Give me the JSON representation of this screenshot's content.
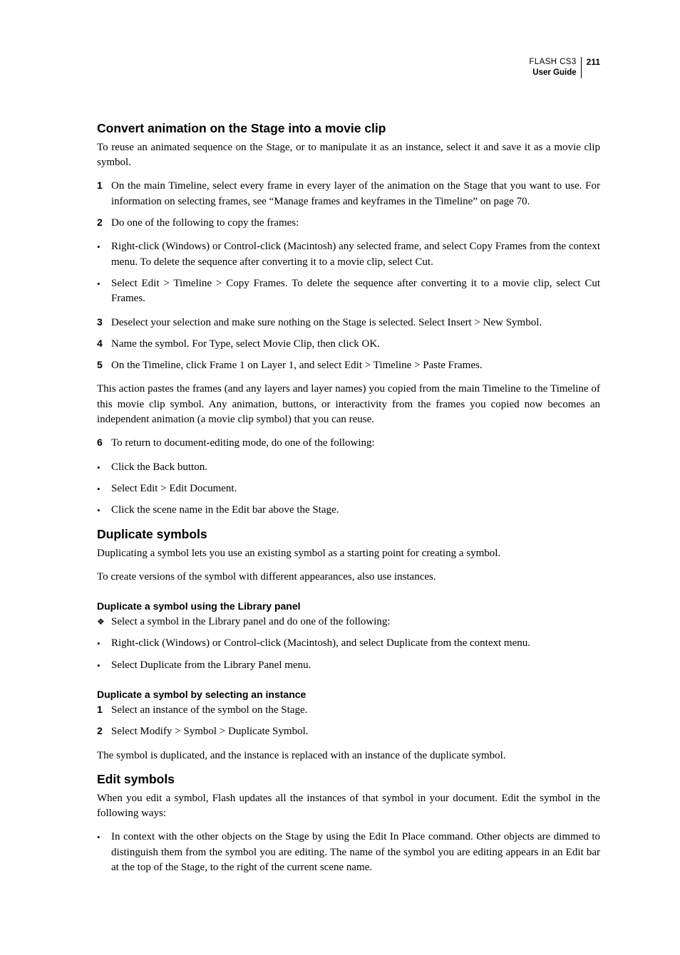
{
  "header": {
    "title": "FLASH CS3",
    "subtitle": "User Guide",
    "page_num": "211"
  },
  "s1": {
    "heading": "Convert animation on the Stage into a movie clip",
    "intro": "To reuse an animated sequence on the Stage, or to manipulate it as an instance, select it and save it as a movie clip symbol.",
    "step1": "On the main Timeline, select every frame in every layer of the animation on the Stage that you want to use. For information on selecting frames, see “Manage frames and keyframes in the Timeline” on page 70.",
    "step2": "Do one of the following to copy the frames:",
    "b2a": "Right-click (Windows) or Control-click (Macintosh) any selected frame, and select Copy Frames from the context menu. To delete the sequence after converting it to a movie clip, select Cut.",
    "b2b": "Select Edit > Timeline > Copy Frames. To delete the sequence after converting it to a movie clip, select Cut Frames.",
    "step3": "Deselect your selection and make sure nothing on the Stage is selected. Select Insert > New Symbol.",
    "step4": "Name the symbol. For Type, select Movie Clip, then click OK.",
    "step5": "On the Timeline, click Frame 1 on Layer 1, and select Edit > Timeline > Paste Frames.",
    "after5": "This action pastes the frames (and any layers and layer names) you copied from the main Timeline to the Timeline of this movie clip symbol. Any animation, buttons, or interactivity from the frames you copied now becomes an independent animation (a movie clip symbol) that you can reuse.",
    "step6": "To return to document-editing mode, do one of the following:",
    "b6a": "Click the Back button.",
    "b6b": "Select Edit > Edit Document.",
    "b6c": "Click the scene name in the Edit bar above the Stage."
  },
  "s2": {
    "heading": "Duplicate symbols",
    "p1": "Duplicating a symbol lets you use an existing symbol as a starting point for creating a symbol.",
    "p2": "To create versions of the symbol with different appearances, also use instances.",
    "sub1": "Duplicate a symbol using the Library panel",
    "d1": "Select a symbol in the Library panel and do one of the following:",
    "b1a": "Right-click (Windows) or Control-click (Macintosh), and select Duplicate from the context menu.",
    "b1b": "Select Duplicate from the Library Panel menu.",
    "sub2": "Duplicate a symbol by selecting an instance",
    "step1": "Select an instance of the symbol on the Stage.",
    "step2": "Select Modify > Symbol > Duplicate Symbol.",
    "after": "The symbol is duplicated, and the instance is replaced with an instance of the duplicate symbol."
  },
  "s3": {
    "heading": "Edit symbols",
    "p1": "When you edit a symbol, Flash updates all the instances of that symbol in your document. Edit the symbol in the following ways:",
    "b1": "In context with the other objects on the Stage by using the Edit In Place command. Other objects are dimmed to distinguish them from the symbol you are editing. The name of the symbol you are editing appears in an Edit bar at the top of the Stage, to the right of the current scene name."
  }
}
